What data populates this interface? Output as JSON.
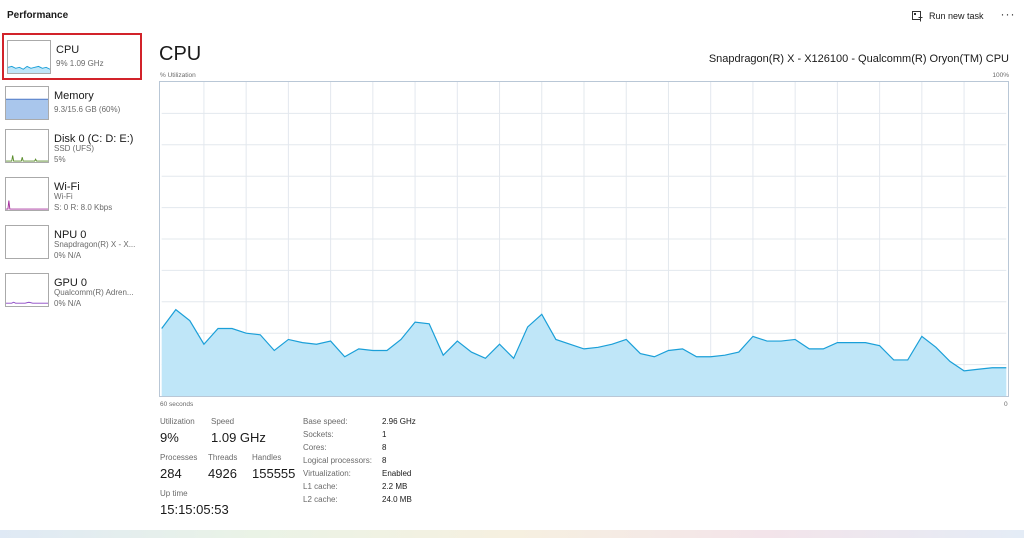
{
  "header": {
    "title": "Performance",
    "run_new_task": "Run new task",
    "more": "···"
  },
  "sidebar": {
    "items": [
      {
        "name": "CPU",
        "line1": "9% 1.09 GHz",
        "line2": "",
        "selected": true
      },
      {
        "name": "Memory",
        "line1": "9.3/15.6 GB (60%)",
        "line2": ""
      },
      {
        "name": "Disk 0 (C: D: E:)",
        "line1": "SSD (UFS)",
        "line2": "5%"
      },
      {
        "name": "Wi-Fi",
        "line1": "Wi-Fi",
        "line2": "S: 0 R: 8.0 Kbps"
      },
      {
        "name": "NPU 0",
        "line1": "Snapdragon(R) X - X...",
        "line2": "0% N/A"
      },
      {
        "name": "GPU 0",
        "line1": "Qualcomm(R) Adren...",
        "line2": "0% N/A"
      }
    ]
  },
  "main": {
    "title": "CPU",
    "model": "Snapdragon(R) X - X126100 - Qualcomm(R) Oryon(TM) CPU",
    "y_axis_label": "% Utilization",
    "y_max_label": "100%",
    "x_start_label": "60 seconds",
    "x_end_label": "0"
  },
  "stats": {
    "utilization_label": "Utilization",
    "utilization": "9%",
    "speed_label": "Speed",
    "speed": "1.09 GHz",
    "processes_label": "Processes",
    "processes": "284",
    "threads_label": "Threads",
    "threads": "4926",
    "handles_label": "Handles",
    "handles": "155555",
    "uptime_label": "Up time",
    "uptime": "15:15:05:53"
  },
  "specs": [
    {
      "key": "Base speed:",
      "value": "2.96 GHz"
    },
    {
      "key": "Sockets:",
      "value": "1"
    },
    {
      "key": "Cores:",
      "value": "8"
    },
    {
      "key": "Logical processors:",
      "value": "8"
    },
    {
      "key": "Virtualization:",
      "value": "Enabled"
    },
    {
      "key": "L1 cache:",
      "value": "2.2 MB"
    },
    {
      "key": "L2 cache:",
      "value": "24.0 MB"
    }
  ],
  "colors": {
    "cpu_line": "#1a9fd8",
    "cpu_fill": "#bfe6f8",
    "memory_fill": "#a9c6ec",
    "memory_line": "#4f79c7",
    "disk_line": "#5b8d2d",
    "wifi_line": "#a6329e",
    "gpu_line": "#8a45c4",
    "grid": "#e3e8ee",
    "selected_border": "#d2232a"
  },
  "chart_data": {
    "type": "area",
    "ylim": [
      0,
      100
    ],
    "x": [
      -60,
      -59,
      -58,
      -57,
      -56,
      -55,
      -54,
      -53,
      -52,
      -51,
      -50,
      -49,
      -48,
      -47,
      -46,
      -45,
      -44,
      -43,
      -42,
      -41,
      -40,
      -39,
      -38,
      -37,
      -36,
      -35,
      -34,
      -33,
      -32,
      -31,
      -30,
      -29,
      -28,
      -27,
      -26,
      -25,
      -24,
      -23,
      -22,
      -21,
      -20,
      -19,
      -18,
      -17,
      -16,
      -15,
      -14,
      -13,
      -12,
      -11,
      -10,
      -9,
      -8,
      -7,
      -6,
      -5,
      -4,
      -3,
      -2,
      -1,
      0
    ],
    "values": [
      21.5,
      27.5,
      24,
      16.5,
      21.5,
      21.5,
      20,
      19.5,
      14.5,
      18,
      17,
      16.5,
      17.5,
      12.5,
      15,
      14.5,
      14.5,
      18,
      23.5,
      23,
      13,
      17.5,
      14,
      12,
      16.5,
      12,
      22,
      26,
      18,
      16.5,
      15,
      15.5,
      16.5,
      18,
      13.5,
      12.5,
      14.5,
      15,
      12.5,
      12.5,
      13,
      14,
      19,
      17.5,
      17.5,
      18,
      15,
      15,
      17,
      17,
      17,
      16,
      11.5,
      11.5,
      19,
      15.5,
      11,
      8,
      8.5,
      9,
      9
    ]
  }
}
